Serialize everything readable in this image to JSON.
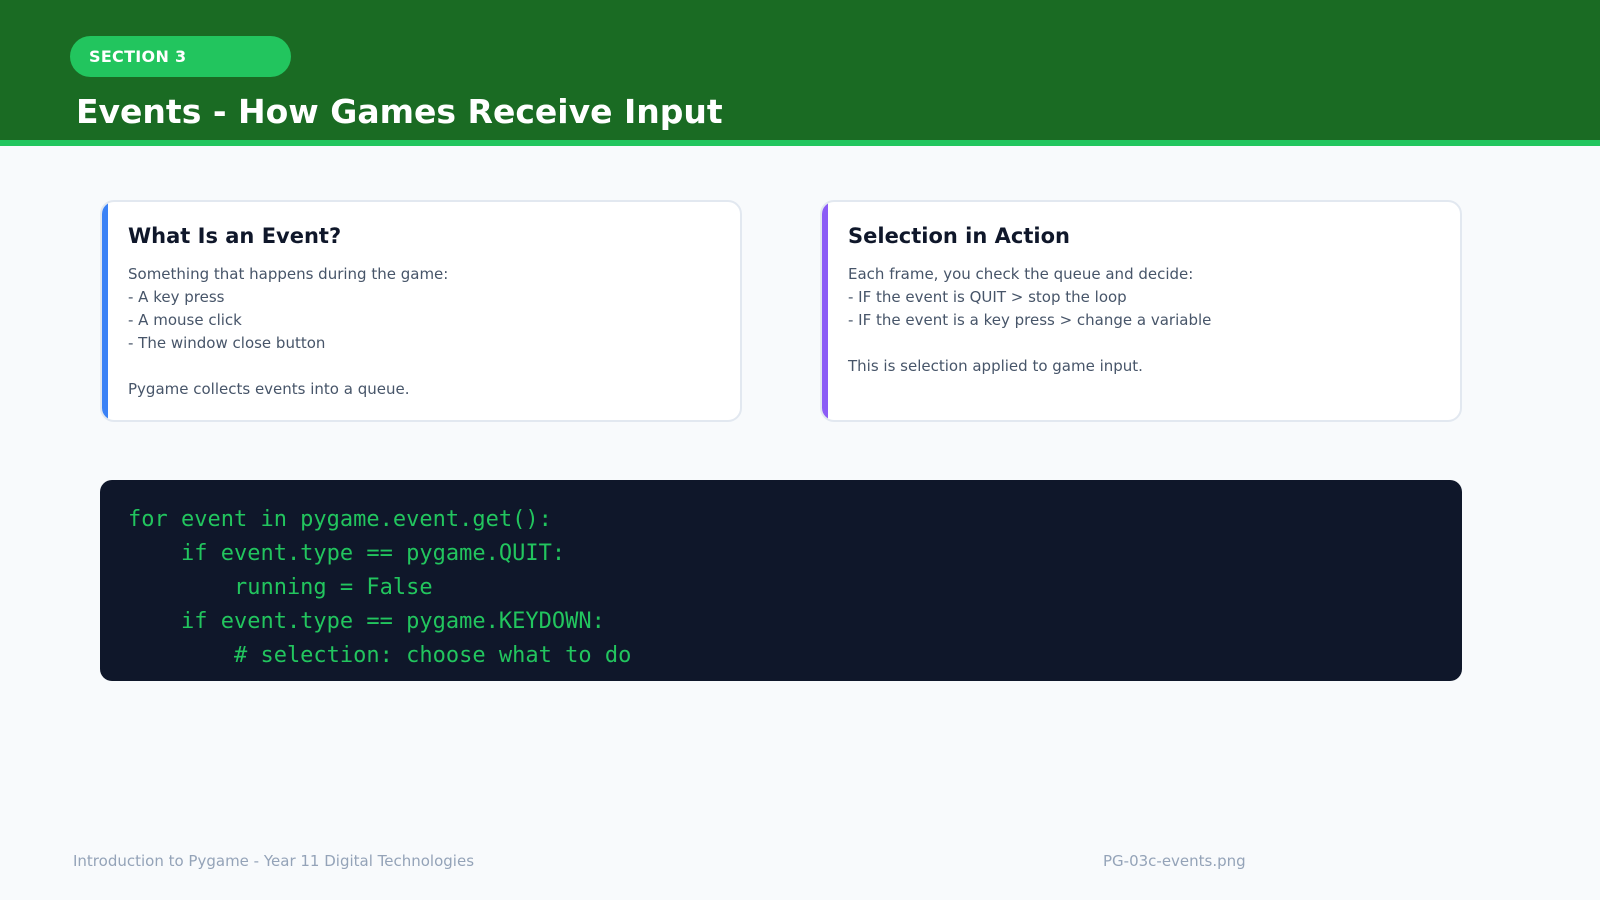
{
  "header": {
    "section_label": "SECTION 3",
    "title": "Events - How Games Receive Input"
  },
  "cards": [
    {
      "heading": "What Is an Event?",
      "lines": [
        "Something that happens during the game:",
        "- A key press",
        "- A mouse click",
        "- The window close button",
        "",
        "Pygame collects events into a queue."
      ]
    },
    {
      "heading": "Selection in Action",
      "lines": [
        "Each frame, you check the queue and decide:",
        "- IF the event is QUIT > stop the loop",
        "- IF the event is a key press > change a variable",
        "",
        "This is selection applied to game input."
      ]
    }
  ],
  "code": {
    "lines": [
      "for event in pygame.event.get():",
      "    if event.type == pygame.QUIT:",
      "        running = False",
      "    if event.type == pygame.KEYDOWN:",
      "        # selection: choose what to do"
    ]
  },
  "footer": {
    "course": "Introduction to Pygame - Year 11 Digital Technologies",
    "filename": "PG-03c-events.png"
  },
  "colors": {
    "header_bg": "#1a6b23",
    "accent_green": "#22c55e",
    "card_left_accent": "#3b82f6",
    "card_right_accent": "#8b5cf6",
    "code_bg": "#0f172a"
  }
}
